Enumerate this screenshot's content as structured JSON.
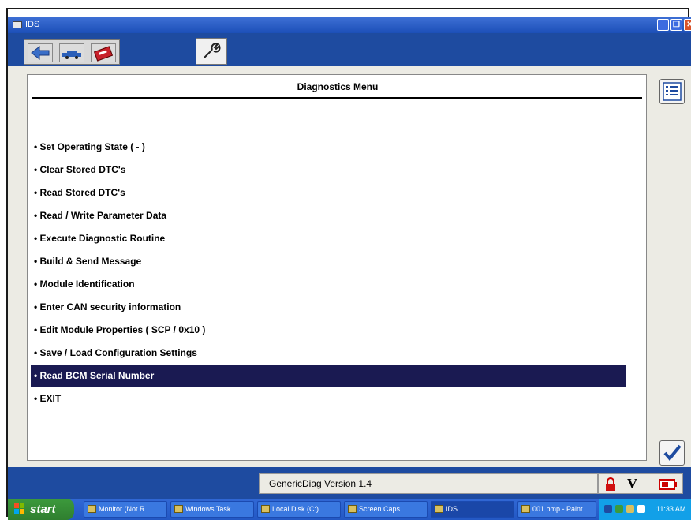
{
  "window": {
    "title": "IDS"
  },
  "menu": {
    "title": "Diagnostics Menu",
    "items": [
      "• Set Operating State ( - )",
      "• Clear Stored DTC's",
      "• Read Stored DTC's",
      "• Read / Write Parameter Data",
      "• Execute Diagnostic Routine",
      "• Build & Send Message",
      "• Module Identification",
      "• Enter CAN security information",
      "• Edit Module Properties ( SCP / 0x10 )",
      "• Save / Load Configuration Settings",
      "• Read BCM Serial Number",
      "• EXIT"
    ],
    "selected_index": 10
  },
  "status": {
    "version_text": "GenericDiag Version 1.4",
    "v_label": "V"
  },
  "taskbar": {
    "start_label": "start",
    "items": [
      "Monitor (Not R...",
      "Windows Task ...",
      "Local Disk (C:)",
      "Screen Caps",
      "IDS",
      "001.bmp - Paint"
    ],
    "clock": "11:33 AM"
  },
  "colors": {
    "app_blue": "#1e4ba0",
    "selected_row": "#1a1a52",
    "panel_bg": "#ecebe4"
  }
}
